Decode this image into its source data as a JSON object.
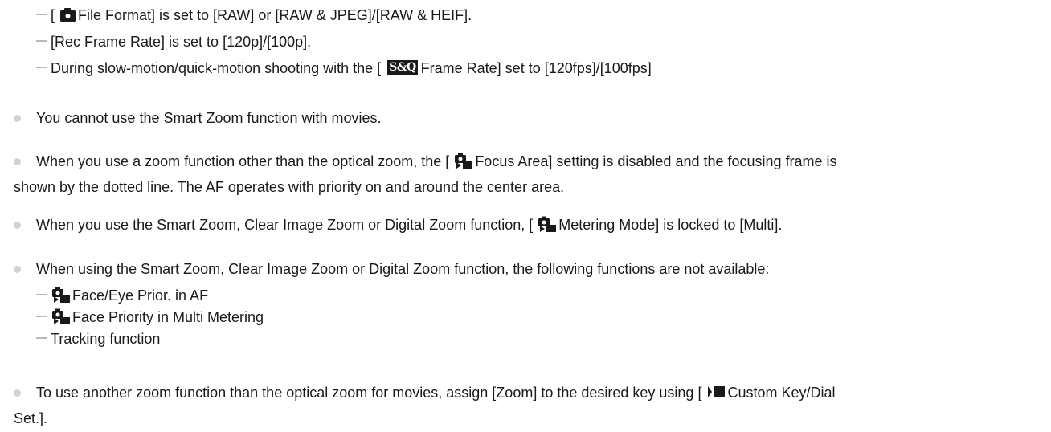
{
  "sublist_top": [
    {
      "pre": "[ ",
      "icon": "camera-icon",
      "post": "File Format] is set to [RAW] or [RAW & JPEG]/[RAW & HEIF]."
    },
    {
      "pre": "",
      "icon": "",
      "post": "[Rec Frame Rate] is set to [120p]/[100p]."
    },
    {
      "pre": "During slow-motion/quick-motion shooting with the [ ",
      "icon": "sq-icon",
      "icon_text": "S&Q",
      "post": "Frame Rate] set to [120fps]/[100fps]"
    }
  ],
  "bullets": {
    "smart_zoom": "You cannot use the Smart Zoom function with movies.",
    "focus_area_pre": "When you use a zoom function other than the optical zoom, the [ ",
    "focus_area_post": "Focus Area] setting is disabled and the focusing frame is",
    "focus_area_line2": "shown by the dotted line. The AF operates with priority on and around the center area.",
    "metering_pre": "When you use the Smart Zoom, Clear Image Zoom or Digital Zoom function, [ ",
    "metering_post": "Metering Mode] is locked to [Multi].",
    "unavailable": "When using the Smart Zoom, Clear Image Zoom or Digital Zoom function, the following functions are not available:",
    "custom_key_pre": "To use another zoom function than the optical zoom for movies, assign [Zoom] to the desired key using [ ",
    "custom_key_post": "Custom Key/Dial",
    "custom_key_line2": "Set.]."
  },
  "sublist_unavailable": [
    {
      "icon": "photo-movie-icon",
      "text": "Face/Eye Prior. in AF"
    },
    {
      "icon": "photo-movie-icon",
      "text": "Face Priority in Multi Metering"
    },
    {
      "icon": "",
      "text": "Tracking function"
    }
  ],
  "colors": {
    "text": "#1a1a1a",
    "bullet": "#d2d2d2",
    "dash": "#b8b8b8"
  }
}
